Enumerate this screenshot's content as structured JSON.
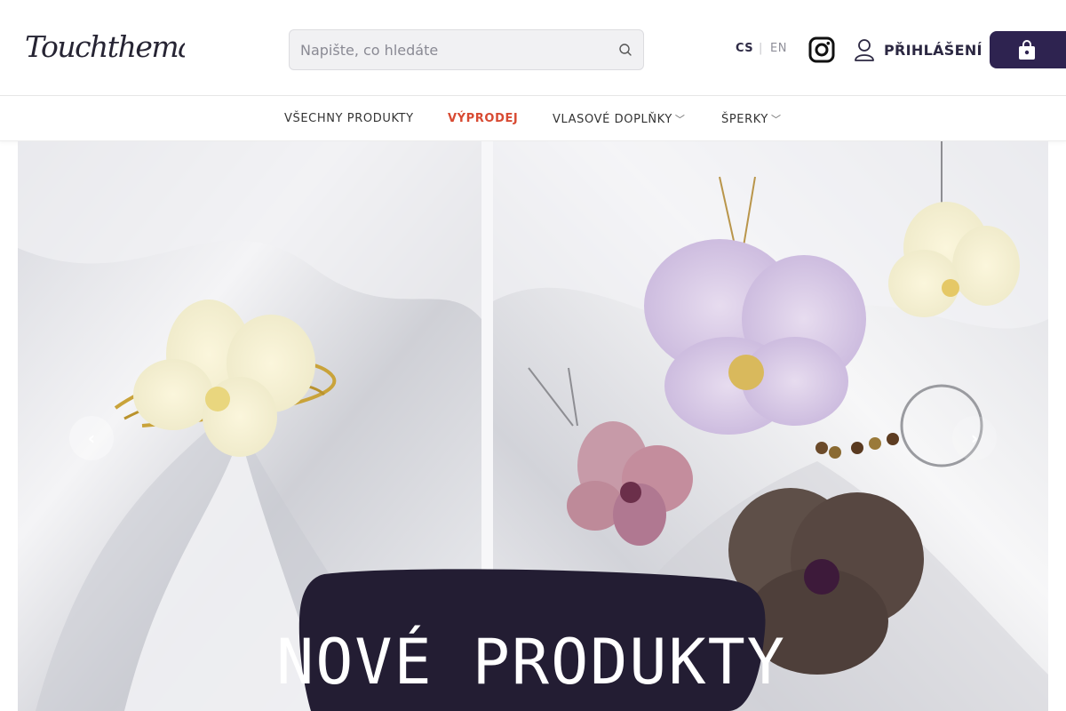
{
  "header": {
    "logo_text": "Touchthemagic",
    "search_placeholder": "Napište, co hledáte",
    "lang_active": "CS",
    "lang_separator": "|",
    "lang_other": "EN",
    "login_label": "PŘIHLÁŠENÍ"
  },
  "nav": {
    "items": [
      {
        "label": "VŠECHNY PRODUKTY",
        "has_dropdown": false
      },
      {
        "label": "VÝPRODEJ",
        "has_dropdown": false
      },
      {
        "label": "VLASOVÉ DOPLŇKY",
        "has_dropdown": true
      },
      {
        "label": "ŠPERKY",
        "has_dropdown": true
      }
    ],
    "dropdown_glyph": "﹀"
  },
  "hero": {
    "banner_text": "NOVÉ PRODUKTY",
    "prev_glyph": "‹",
    "next_glyph": "›"
  },
  "colors": {
    "brand_dark": "#2e2350",
    "sale_red": "#d84a32",
    "banner_dark": "#231d33"
  },
  "icons": [
    "search-icon",
    "instagram-icon",
    "user-icon",
    "shopping-bag-icon",
    "chevron-left-icon",
    "chevron-right-icon"
  ]
}
